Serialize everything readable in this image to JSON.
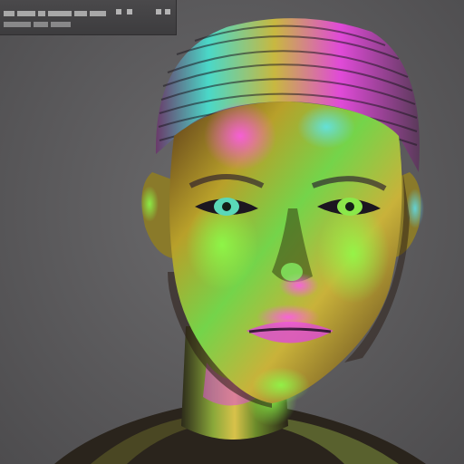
{
  "image": {
    "subject": "iridescent-metallic-humanoid-head"
  },
  "colors": {
    "background": "#5e5d5f",
    "skin_gold": "#c9b23a",
    "skin_green": "#6fdc4a",
    "skin_magenta": "#e04ad8",
    "skin_cyan": "#4ad8e0",
    "shadow": "#2a1c2e"
  }
}
